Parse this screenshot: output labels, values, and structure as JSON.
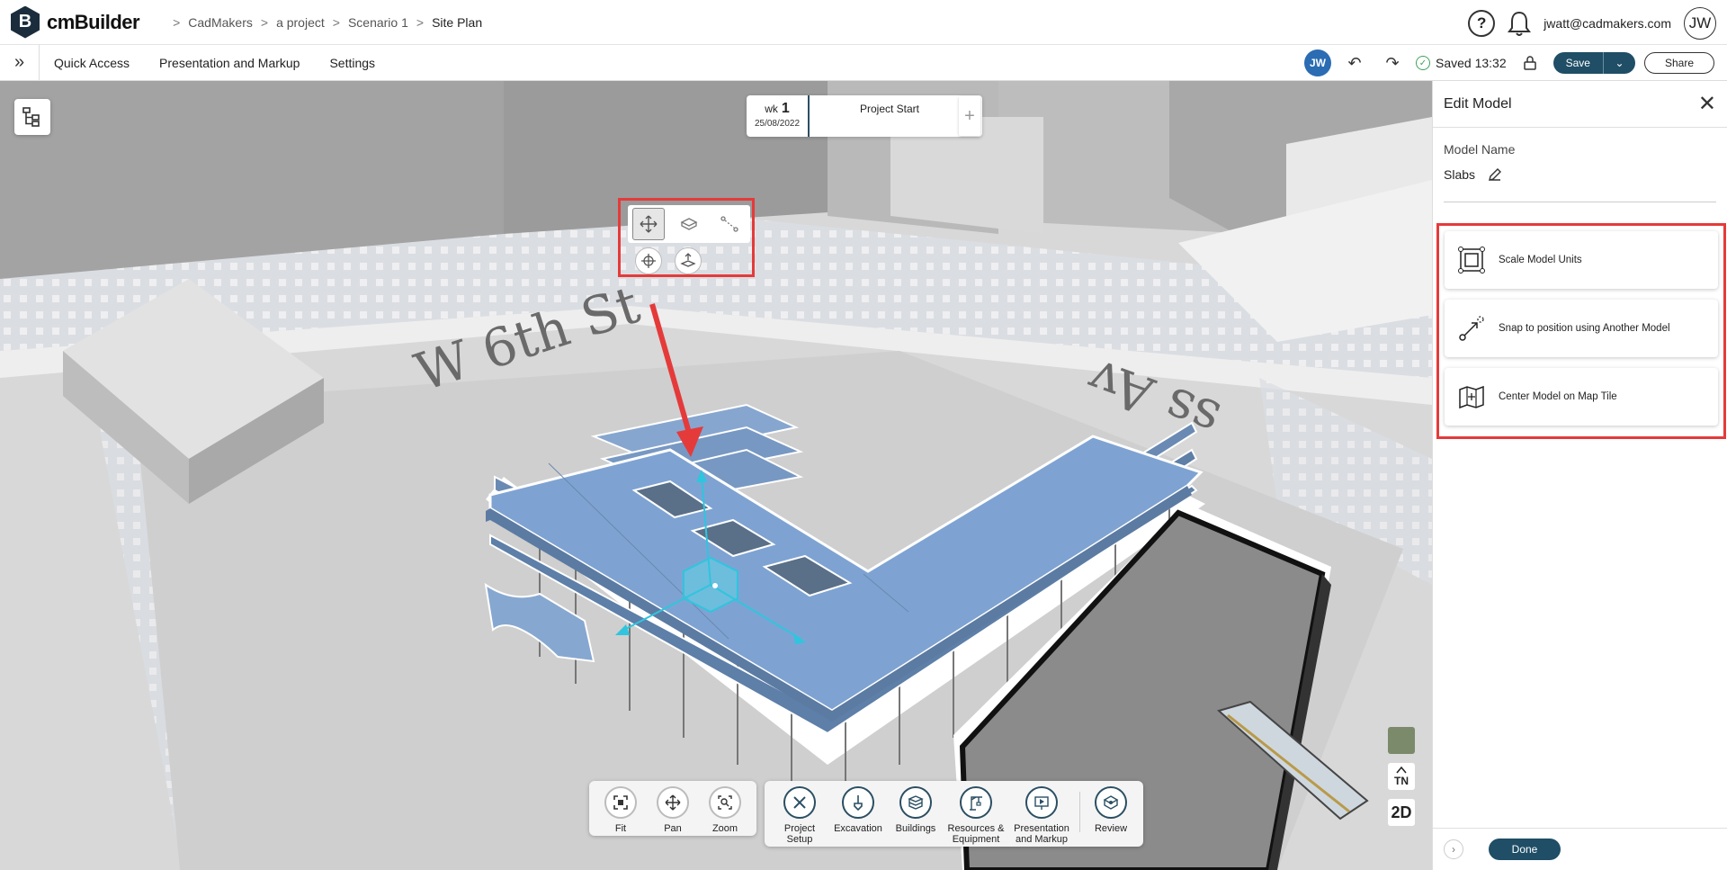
{
  "app": {
    "logo_letter": "B",
    "name": "cmBuilder"
  },
  "breadcrumb": [
    "CadMakers",
    "a project",
    "Scenario 1",
    "Site Plan"
  ],
  "header": {
    "help": "?",
    "user_email": "jwatt@cadmakers.com",
    "user_initials": "JW"
  },
  "menu": {
    "items": [
      "Quick Access",
      "Presentation and Markup",
      "Settings"
    ]
  },
  "toolbar": {
    "avatar_initials": "JW",
    "saved_text": "Saved 13:32",
    "save_label": "Save",
    "share_label": "Share"
  },
  "timeline": {
    "wk_label": "wk",
    "wk_number": "1",
    "date": "25/08/2022",
    "title": "Project Start",
    "add": "+"
  },
  "map_labels": {
    "street_1": "W 6th St",
    "street_2": "ss Av"
  },
  "map_tools": {
    "north": "TN",
    "view_mode": "2D"
  },
  "view_tools": [
    {
      "label": "Fit"
    },
    {
      "label": "Pan"
    },
    {
      "label": "Zoom"
    }
  ],
  "main_tools": [
    {
      "label": "Project Setup"
    },
    {
      "label": "Excavation"
    },
    {
      "label": "Buildings"
    },
    {
      "label": "Resources & Equipment"
    },
    {
      "label": "Presentation and Markup"
    },
    {
      "label": "Review"
    }
  ],
  "edit_panel": {
    "title": "Edit Model",
    "model_name_label": "Model Name",
    "model_name_value": "Slabs",
    "options": [
      {
        "label": "Scale Model Units",
        "icon": "scale-icon"
      },
      {
        "label": "Snap to position using Another Model",
        "icon": "snap-icon"
      },
      {
        "label": "Center Model on Map Tile",
        "icon": "map-center-icon"
      }
    ],
    "done_label": "Done"
  },
  "colors": {
    "accent": "#1f4e66",
    "highlight": "#e53a3a",
    "model": "#7ea3d2",
    "saved_ok": "#3fa35b"
  }
}
